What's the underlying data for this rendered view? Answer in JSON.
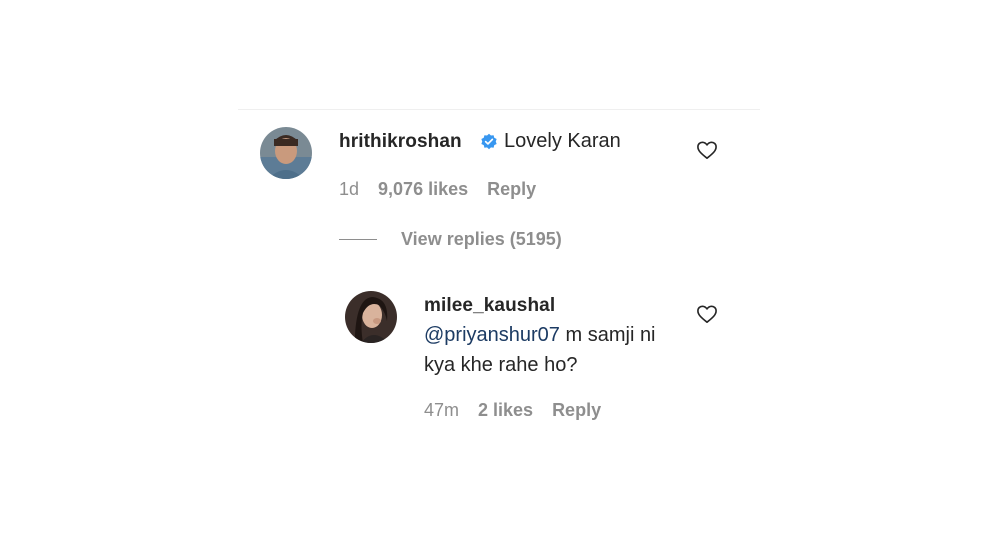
{
  "comment": {
    "username": "hrithikroshan",
    "text": "Lovely Karan",
    "time": "1d",
    "likes": "9,076 likes",
    "reply_label": "Reply",
    "verified_icon": "verified-badge-icon",
    "like_icon": "heart-icon"
  },
  "view_replies": {
    "label": "View replies (5195)"
  },
  "reply": {
    "username": "milee_kaushal",
    "mention": "@priyanshur07",
    "text": " m samji ni kya khe rahe ho?",
    "time": "47m",
    "likes": "2 likes",
    "reply_label": "Reply",
    "like_icon": "heart-icon"
  },
  "colors": {
    "verified_blue": "#3897f0",
    "mention_blue": "#1c3b63",
    "muted_gray": "#8e8e8e",
    "text_dark": "#262626"
  }
}
